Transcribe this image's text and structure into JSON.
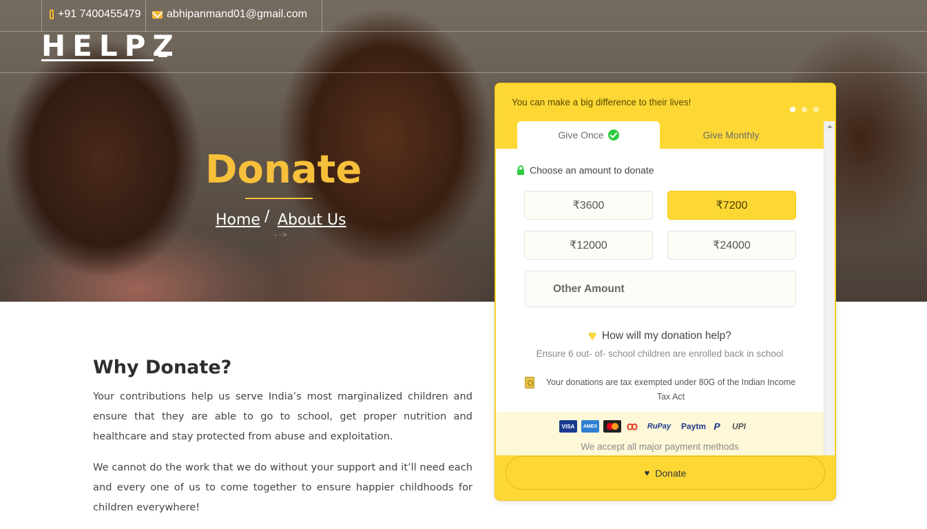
{
  "topbar": {
    "phone": "+91 7400455479",
    "email": "abhipanmand01@gmail.com"
  },
  "brand": {
    "logo": "HELPZ"
  },
  "hero": {
    "title": "Donate",
    "breadcrumb": [
      {
        "label": "Home"
      },
      {
        "label": "About Us"
      }
    ],
    "separator": "/",
    "arrow": "-->"
  },
  "why": {
    "title": "Why Donate?",
    "paragraphs": [
      "Your contributions help us serve India’s most marginalized children and ensure that they are able to go to school, get proper nutrition and healthcare and stay protected from abuse and exploitation.",
      "We cannot do the work that we do without your support and it’ll need each and every one of us to come together to ensure happier childhoods for children everywhere!"
    ]
  },
  "widget": {
    "heading": "You can make a big difference to their lives!",
    "slides": {
      "count": 3,
      "active": 1
    },
    "tabs": [
      {
        "label": "Give Once",
        "active": true
      },
      {
        "label": "Give Monthly",
        "active": false
      }
    ],
    "choose_label": "Choose an amount to donate",
    "amounts": [
      {
        "label": "₹3600",
        "selected": false
      },
      {
        "label": "₹7200",
        "selected": true
      },
      {
        "label": "₹12000",
        "selected": false
      },
      {
        "label": "₹24000",
        "selected": false
      }
    ],
    "other_amount_placeholder": "Other Amount",
    "help_question": "How will my donation help?",
    "help_answer": "Ensure 6 out- of- school children are enrolled back in school",
    "tax_note": "Your donations are tax exempted under 80G of the Indian Income Tax Act",
    "payment_methods": [
      "VISA",
      "AMEX",
      "Mastercard",
      "Airtel",
      "RuPay",
      "Paytm",
      "PayPal",
      "UPI"
    ],
    "payment_note": "We accept all major payment methods",
    "donate_button": "Donate"
  },
  "colors": {
    "accent": "#fdd835",
    "title_gold": "#f7c03a",
    "check_green": "#2ecc40"
  }
}
